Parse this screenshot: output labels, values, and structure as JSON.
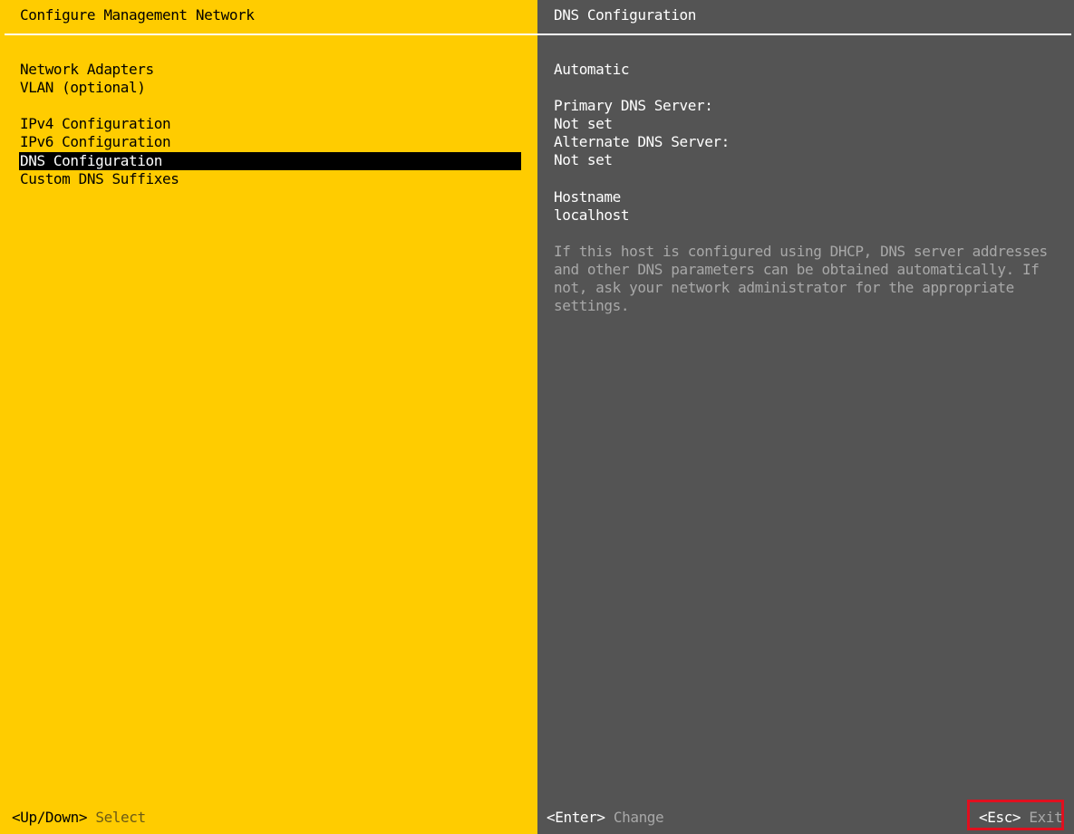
{
  "left_panel": {
    "title": "Configure Management Network",
    "menu_items": [
      {
        "label": "Network Adapters",
        "selected": false
      },
      {
        "label": "VLAN (optional)",
        "selected": false
      },
      {
        "label": "IPv4 Configuration",
        "selected": false
      },
      {
        "label": "IPv6 Configuration",
        "selected": false
      },
      {
        "label": "DNS Configuration",
        "selected": true
      },
      {
        "label": "Custom DNS Suffixes",
        "selected": false
      }
    ],
    "footer": {
      "key": "<Up/Down>",
      "action": "Select"
    }
  },
  "right_panel": {
    "title": "DNS Configuration",
    "mode": "Automatic",
    "primary_dns_label": "Primary DNS Server:",
    "primary_dns_value": "Not set",
    "alternate_dns_label": "Alternate DNS Server:",
    "alternate_dns_value": "Not set",
    "hostname_label": "Hostname",
    "hostname_value": "localhost",
    "help_text": "If this host is configured using DHCP, DNS server addresses\nand other DNS parameters can be obtained automatically. If\nnot, ask your network administrator for the appropriate\nsettings.",
    "footer_enter": {
      "key": "<Enter>",
      "action": "Change"
    },
    "footer_esc": {
      "key": "<Esc>",
      "action": "Exit"
    }
  },
  "colors": {
    "left_background": "#ffcc00",
    "right_background": "#545454",
    "selection_background": "#000000",
    "highlight_box": "#e0101f"
  }
}
